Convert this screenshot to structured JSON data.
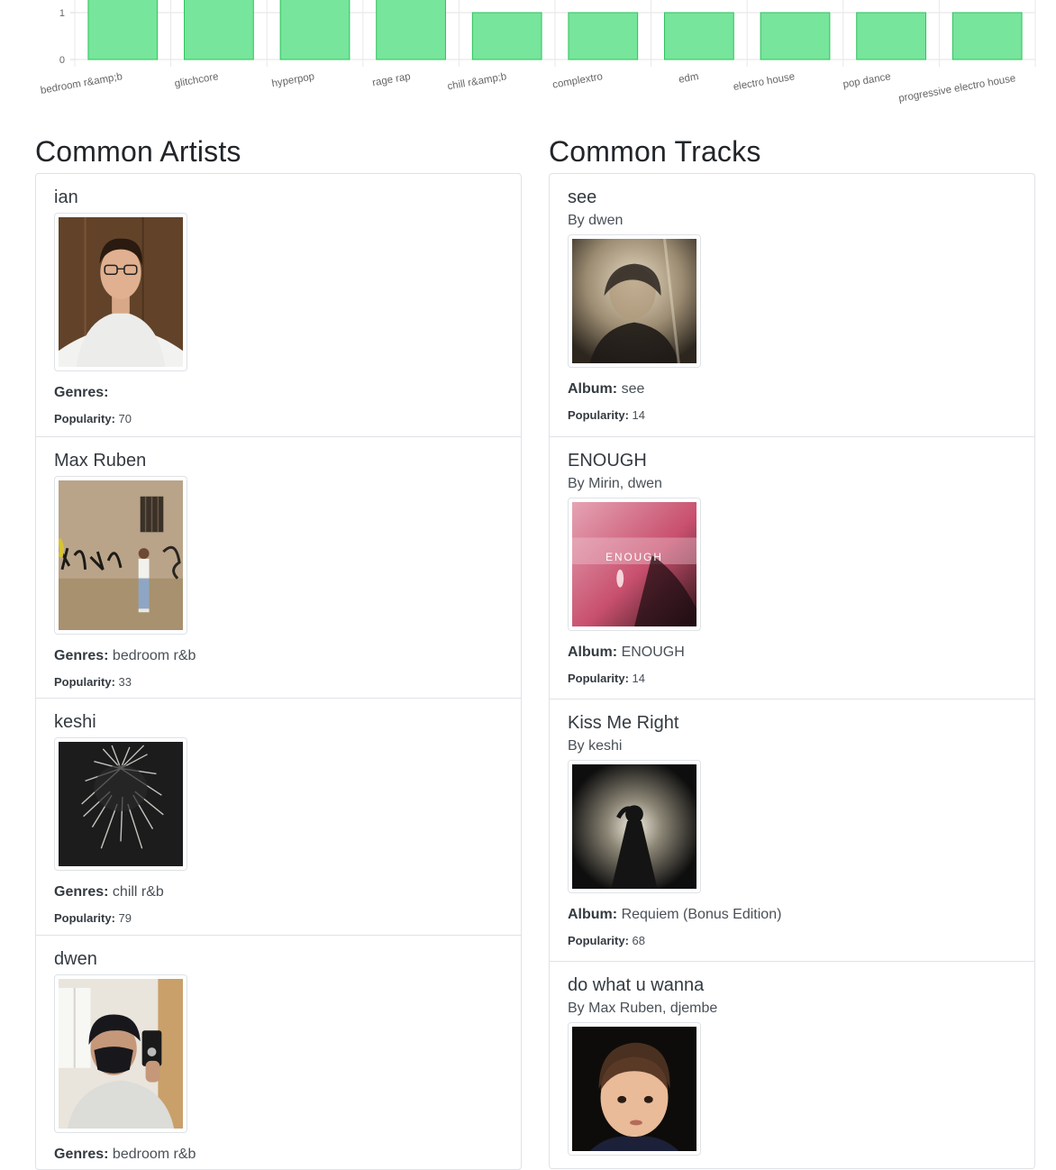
{
  "chart_data": {
    "type": "bar",
    "categories": [
      "bedroom r&amp;b",
      "glitchcore",
      "hyperpop",
      "rage rap",
      "chill r&amp;b",
      "complextro",
      "edm",
      "electro house",
      "pop dance",
      "progressive electro house"
    ],
    "values": [
      2,
      2,
      2,
      2,
      1,
      1,
      1,
      1,
      1,
      1
    ],
    "y_ticks": [
      "0",
      "1"
    ],
    "bar_color": "#77e59b",
    "bar_border": "#2ec15c",
    "grid": true
  },
  "artists": {
    "title": "Common Artists",
    "items": [
      {
        "name": "ian",
        "genres_label": "Genres:",
        "genres": "",
        "popularity_label": "Popularity:",
        "popularity": "70"
      },
      {
        "name": "Max Ruben",
        "genres_label": "Genres:",
        "genres": "bedroom r&b",
        "popularity_label": "Popularity:",
        "popularity": "33"
      },
      {
        "name": "keshi",
        "genres_label": "Genres:",
        "genres": "chill r&b",
        "popularity_label": "Popularity:",
        "popularity": "79"
      },
      {
        "name": "dwen",
        "genres_label": "Genres:",
        "genres": "bedroom r&b"
      }
    ]
  },
  "tracks": {
    "title": "Common Tracks",
    "items": [
      {
        "name": "see",
        "by": "By dwen",
        "album_label": "Album:",
        "album": "see",
        "popularity_label": "Popularity:",
        "popularity": "14"
      },
      {
        "name": "ENOUGH",
        "by": "By Mirin, dwen",
        "album_label": "Album:",
        "album": "ENOUGH",
        "popularity_label": "Popularity:",
        "popularity": "14",
        "cover_text": "ENOUGH"
      },
      {
        "name": "Kiss Me Right",
        "by": "By keshi",
        "album_label": "Album:",
        "album": "Requiem (Bonus Edition)",
        "popularity_label": "Popularity:",
        "popularity": "68"
      },
      {
        "name": "do what u wanna",
        "by": "By Max Ruben, djembe"
      }
    ]
  }
}
